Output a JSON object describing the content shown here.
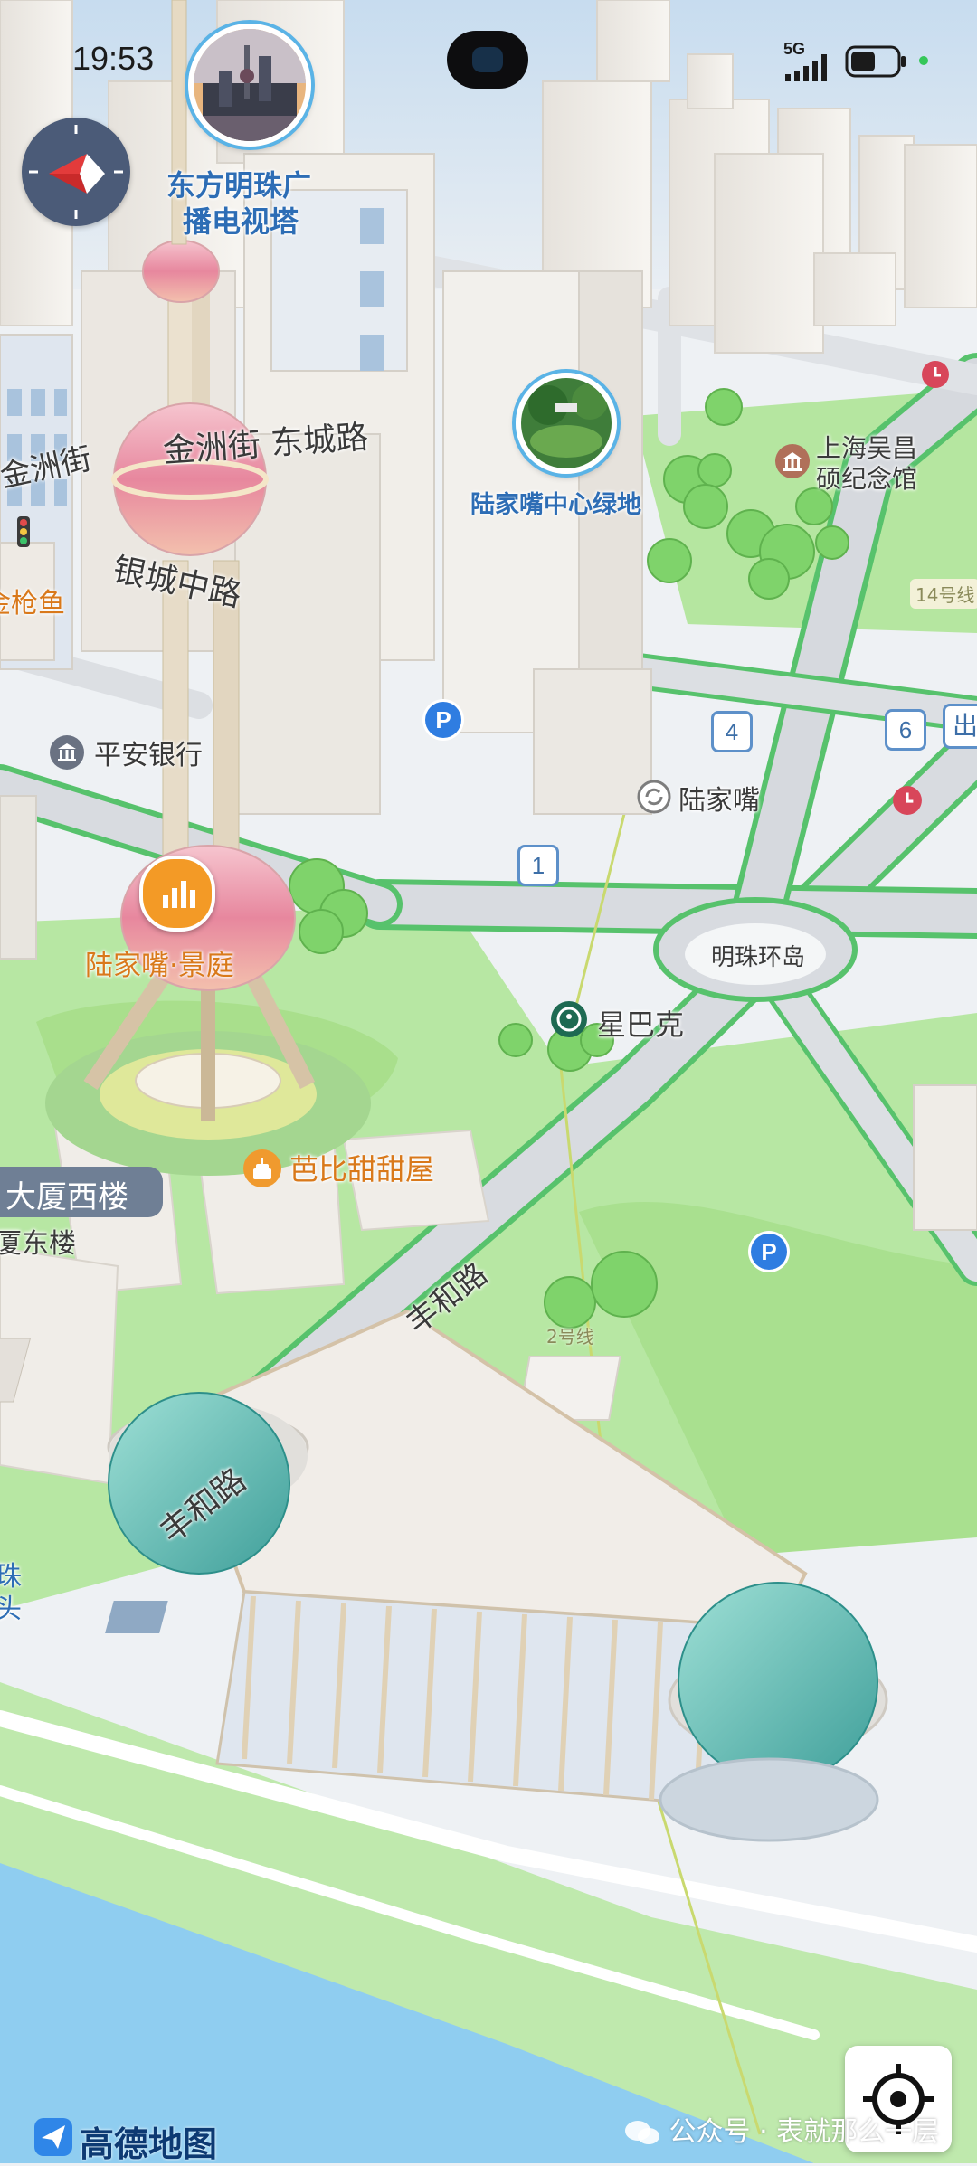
{
  "status_bar": {
    "time": "19:53",
    "network": "5G",
    "battery_level": 0.55
  },
  "pois": {
    "oriental_pearl_tower": [
      "东方明珠广",
      "播电视塔"
    ],
    "lujiazui_green": "陆家嘴中心绿地",
    "wuchang_memorial": [
      "上海吴昌",
      "硕纪念馆"
    ],
    "pingan_bank": "平安银行",
    "lujiazui_jingting": "陆家嘴·景庭",
    "starbucks": "星巴克",
    "babi_cake": "芭比甜甜屋",
    "lujiazui_station": "陆家嘴",
    "mingzhu_roundabout": "明珠环岛",
    "dasha_west": "大厦西楼",
    "dasha_east": "厦东楼",
    "jinqiangyu": "金枪鱼",
    "zhu_tou": [
      "珠",
      "头"
    ],
    "metro_line_14": "14号线",
    "metro_line_2": "2号线",
    "exit_partial": "出"
  },
  "roads": {
    "jinzhou_street": "金洲街",
    "jinzhou_dongcheng": "金洲街 东城路",
    "yincheng_middle": "银城中路",
    "fenghe_1": "丰和路",
    "fenghe_2": "丰和路"
  },
  "exits": [
    "1",
    "4",
    "6"
  ],
  "parking_label": "P",
  "brand": {
    "name": "高德地图"
  },
  "watermark": "公众号 · 表就那么一层",
  "colors": {
    "park_green": "#a9e08f",
    "road": "#d9dde2",
    "road_edge": "#57c26c",
    "water": "#8fcdf0",
    "building": "#f2efe9",
    "accent_blue": "#2f7de1",
    "poi_orange": "#f0a02e"
  },
  "icons": {
    "compass": "compass-icon",
    "locate": "locate-icon",
    "parking": "parking-icon",
    "station": "metro-station-icon",
    "bank": "bank-icon",
    "museum": "museum-icon",
    "cafe": "starbucks-icon",
    "bakery": "bakery-icon",
    "chart": "bar-chart-icon",
    "clock": "clock-icon"
  }
}
